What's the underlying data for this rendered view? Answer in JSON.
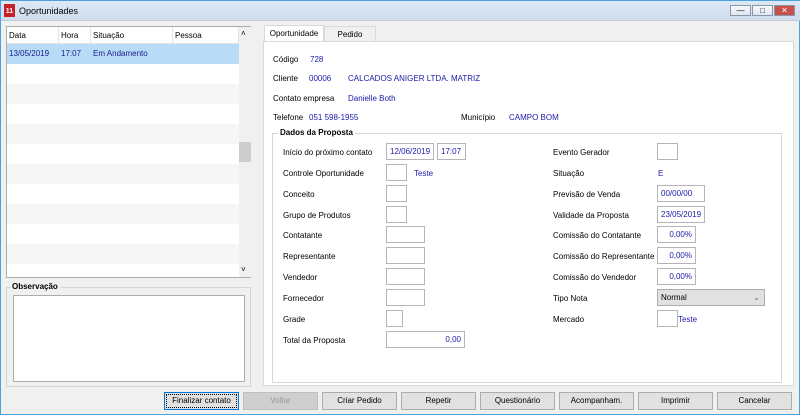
{
  "window": {
    "title": "Oportunidades",
    "controls": {
      "minimize": "—",
      "maximize": "□",
      "close": "✕"
    }
  },
  "grid": {
    "columns": [
      "Data",
      "Hora",
      "Situação",
      "Pessoa"
    ],
    "rows": [
      {
        "data": "13/05/2019",
        "hora": "17:07",
        "situacao": "Em Andamento",
        "pessoa": ""
      }
    ],
    "scroll_up": "˄",
    "scroll_down": "˅"
  },
  "observacao": {
    "label": "Observação",
    "value": ""
  },
  "tabs": [
    "Oportunidade",
    "Pedido"
  ],
  "header": {
    "codigo_label": "Código",
    "codigo": "728",
    "cliente_label": "Cliente",
    "cliente_code": "00006",
    "cliente_name": "CALCADOS ANIGER LTDA. MATRIZ",
    "contato_label": "Contato empresa",
    "contato": "Danielle Both",
    "telefone_label": "Telefone",
    "telefone": "051 598-1955",
    "municipio_label": "Município",
    "municipio": "CAMPO BOM"
  },
  "proposta": {
    "title": "Dados da Proposta",
    "left": [
      {
        "label": "Início do próximo contato",
        "value": "12/06/2019",
        "value2": "17:07"
      },
      {
        "label": "Controle Oportunidade",
        "value": "",
        "extra": "Teste"
      },
      {
        "label": "Conceito",
        "value": ""
      },
      {
        "label": "Grupo de Produtos",
        "value": ""
      },
      {
        "label": "Contatante",
        "value": ""
      },
      {
        "label": "Representante",
        "value": ""
      },
      {
        "label": "Vendedor",
        "value": ""
      },
      {
        "label": "Fornecedor",
        "value": ""
      },
      {
        "label": "Grade",
        "value": ""
      },
      {
        "label": "Total da Proposta",
        "value": "0,00"
      }
    ],
    "right": [
      {
        "label": "Evento Gerador",
        "value": ""
      },
      {
        "label": "Situação",
        "value": "E"
      },
      {
        "label": "Previsão de Venda",
        "value": "00/00/00"
      },
      {
        "label": "Validade da Proposta",
        "value": "23/05/2019"
      },
      {
        "label": "Comissão do Contatante",
        "value": "0,00%"
      },
      {
        "label": "Comissão do Representante",
        "value": "0,00%"
      },
      {
        "label": "Comissão do Vendedor",
        "value": "0,00%"
      },
      {
        "label": "Tipo Nota",
        "value": "Normal"
      },
      {
        "label": "Mercado",
        "value": "",
        "extra": "Teste"
      }
    ]
  },
  "buttons": [
    "Finalizar contato",
    "Voltar",
    "Criar Pedido",
    "Repetir",
    "Questionário",
    "Acompanham.",
    "Imprimir",
    "Cancelar"
  ]
}
